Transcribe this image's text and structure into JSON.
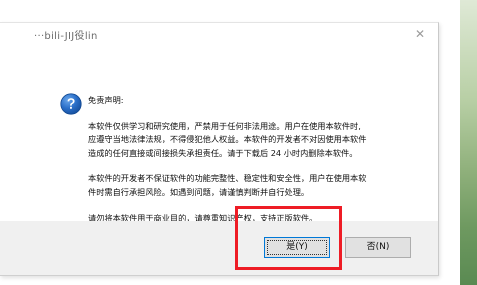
{
  "dialog": {
    "title": "···bili-JIJ役lin",
    "close_glyph": "✕",
    "heading": "免责声明:",
    "paragraphs": [
      [
        "本软件仅供学习和研究使用，严禁用于任何非法用途。用户在使用本软件时,",
        "应遵守当地法律法规，不得侵犯他人权益。本软件的开发者不对因使用本软件",
        "造成的任何直接或间接损失承担责任。请于下载后 24 小时内删除本软件。"
      ],
      [
        "本软件的开发者不保证软件的功能完整性、稳定性和安全性，用户在使用本软",
        "件时需自行承担风险。如遇到问题，请谨慎判断并自行处理。"
      ],
      [
        "请勿将本软件用于商业目的，请尊重知识产权，支持正版软件。"
      ]
    ],
    "buttons": {
      "yes": "是(Y)",
      "no": "否(N)"
    },
    "icon": "question-icon"
  },
  "colors": {
    "highlight": "#ee1c25",
    "icon_blue": "#1f5fb4",
    "footer_bg": "#f0f0f0",
    "focus_border": "#0078d7"
  }
}
